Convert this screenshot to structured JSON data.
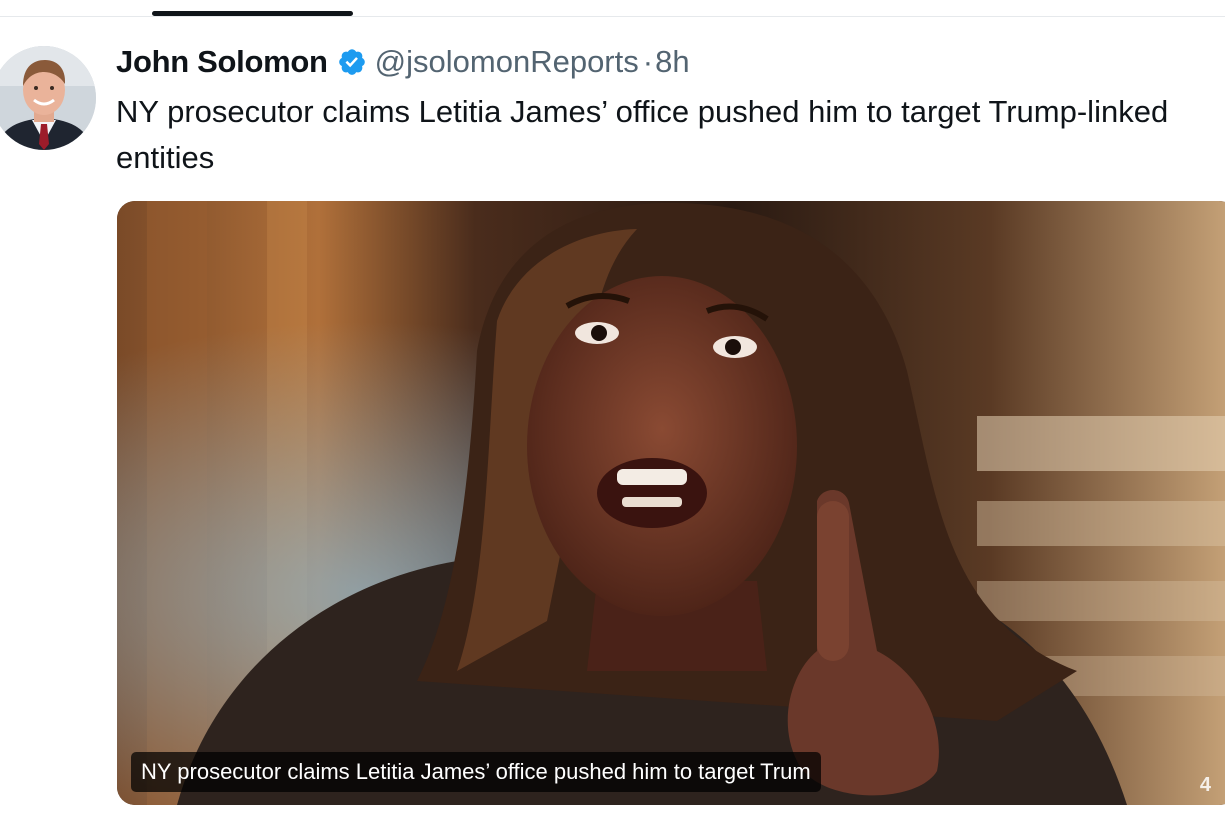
{
  "tabs": {
    "active_indicator": "selected-tab-underline"
  },
  "tweet": {
    "author": {
      "display_name": "John Solomon",
      "handle": "@jsolomonReports",
      "verified": true,
      "avatar_icon": "profile-photo"
    },
    "separator": "·",
    "timestamp": "8h",
    "text": "NY prosecutor claims Letitia James’ office pushed him to target Trump-linked entities",
    "media": {
      "type": "photo",
      "caption": "NY prosecutor claims Letitia James’ office pushed him to target Trum",
      "corner_glyph": "4"
    }
  },
  "colors": {
    "text_primary": "#0f1419",
    "text_secondary": "#536471",
    "verified_blue": "#1d9bf0",
    "divider": "#e6e9ec"
  }
}
